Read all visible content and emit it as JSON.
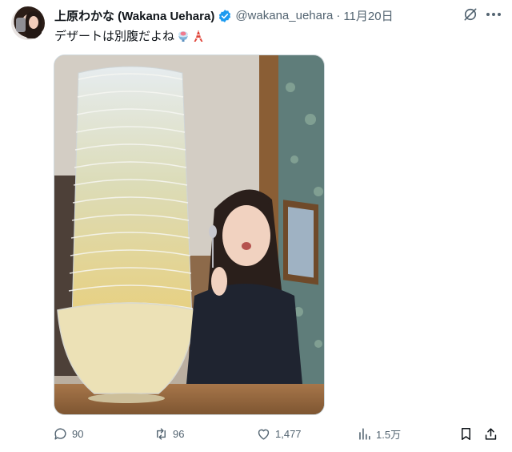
{
  "tweet": {
    "display_name": "上原わかな (Wakana Uehara)",
    "handle": "@wakana_uehara",
    "separator": "·",
    "date": "11月20日",
    "text": "デザートは別腹だよね"
  },
  "icons": {
    "verified": "verified-badge-icon",
    "grok": "grok-icon",
    "more": "more-icon",
    "emoji_1": "shaved-ice-emoji",
    "emoji_2": "tokyo-tower-emoji",
    "reply": "reply-icon",
    "repost": "repost-icon",
    "like": "like-icon",
    "views": "views-icon",
    "bookmark": "bookmark-icon",
    "share": "share-icon"
  },
  "stats": {
    "replies": "90",
    "reposts": "96",
    "likes": "1,477",
    "views": "1.5万"
  },
  "colors": {
    "text": "#0f1419",
    "secondary": "#536471",
    "verified": "#1d9bf0"
  }
}
